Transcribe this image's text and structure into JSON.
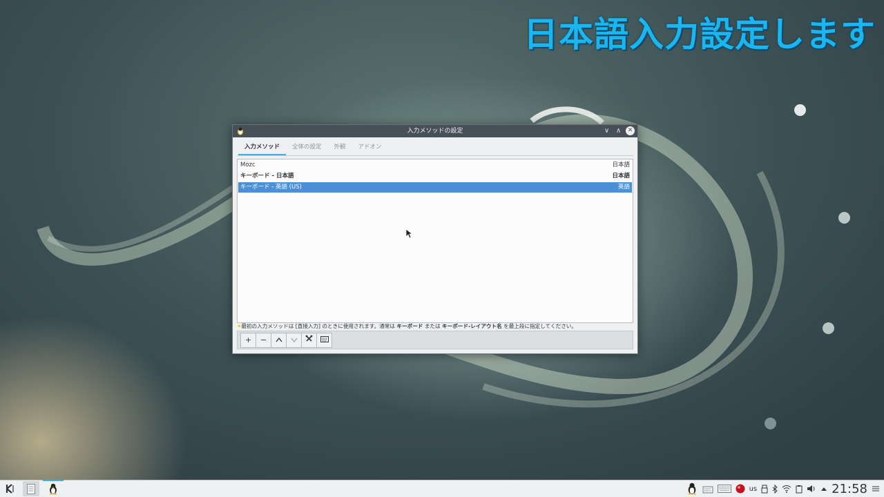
{
  "desktop": {
    "banner": "日本語入力設定します"
  },
  "window": {
    "title": "入力メソッドの設定",
    "tabs": [
      {
        "label": "入力メソッド"
      },
      {
        "label": "全体の設定"
      },
      {
        "label": "外観"
      },
      {
        "label": "アドオン"
      }
    ],
    "methods": [
      {
        "name": "Mozc",
        "lang": "日本語"
      },
      {
        "name": "キーボード - 日本語",
        "lang": "日本語"
      },
      {
        "name": "キーボード - 英語 (US)",
        "lang": "英語"
      }
    ],
    "hint": {
      "part1": "最初の入力メソッドは [直接入力] のときに使用されます。通常は",
      "keyboard": "キーボード",
      "part2": "または",
      "layout": "キーボード-レイアウト名",
      "part3": "を最上段に指定してください。"
    },
    "toolbar": {
      "add": "+",
      "remove": "−",
      "up": "^",
      "down": "v"
    }
  },
  "taskbar": {
    "kbd_layout": "us",
    "clock": "21:58"
  }
}
